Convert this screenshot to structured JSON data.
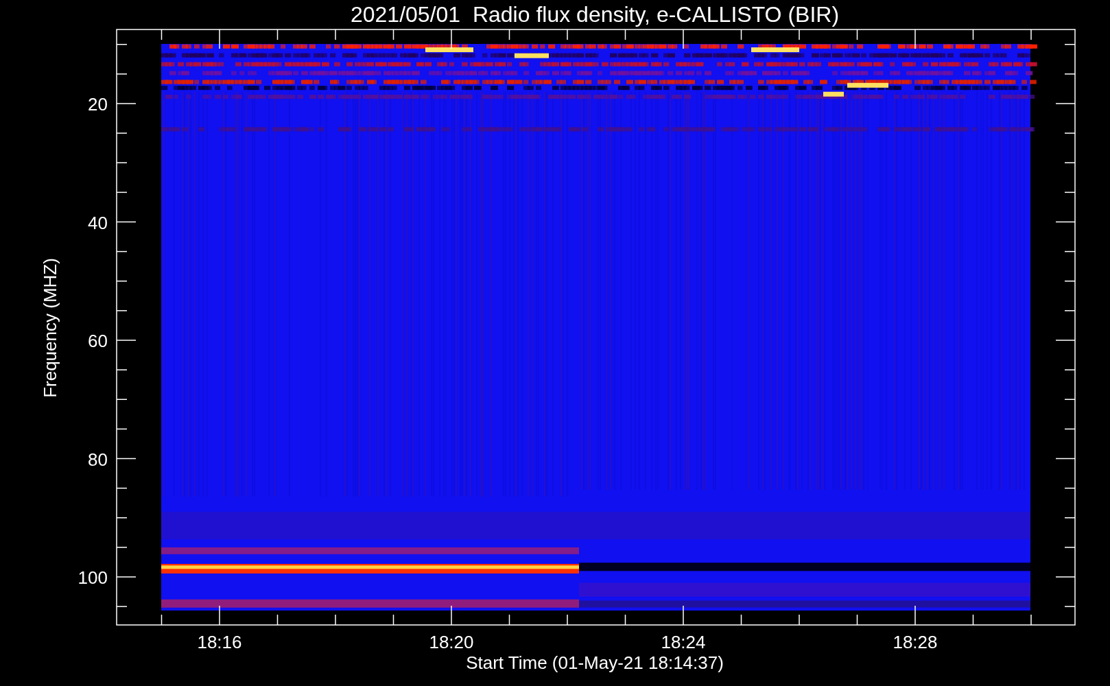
{
  "title": "2021/05/01  Radio flux density, e-CALLISTO (BIR)",
  "y_axis": {
    "label": "Frequency (MHZ)",
    "ticks": [
      "20",
      "40",
      "60",
      "80",
      "100"
    ]
  },
  "x_axis": {
    "label": "Start Time (01-May-21 18:14:37)",
    "ticks": [
      "18:16",
      "18:20",
      "18:24",
      "18:28"
    ]
  }
}
